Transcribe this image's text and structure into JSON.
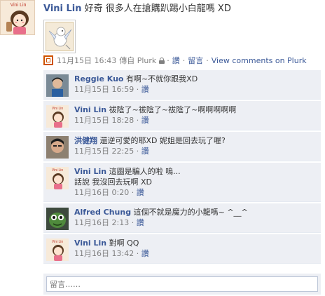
{
  "post": {
    "author": "Vini Lin",
    "text": "好奇 很多人在搶購趴踢小白龍嗎 XD",
    "avatar_caption": "Vini Lin"
  },
  "meta": {
    "timestamp": "11月15日 16:43",
    "via": "傳自 Plurk",
    "like_label": "讚",
    "comment_label": "留言",
    "view_comments_label": "View comments on Plurk",
    "dot": "·"
  },
  "comments": [
    {
      "author": "Reggie Kuo",
      "text": "有啊~不就你跟我XD",
      "timestamp": "11月15日 16:59",
      "like_label": "讚"
    },
    {
      "author": "Vini Lin",
      "text": "祓陰了~祓陰了~祓陰了~啊啊啊啊啊",
      "timestamp": "11月15日 18:28",
      "like_label": "讚",
      "avatar_caption": "Vini Lin"
    },
    {
      "author": "洪健翔",
      "text": "還逆可愛的耶XD 妮姐是回去玩了喔?",
      "timestamp": "11月15日 22:25",
      "like_label": "讚"
    },
    {
      "author": "Vini Lin",
      "text": "這圖是騙人的啦 嗚...",
      "text2": "話說 我沒回去玩啊 XD",
      "timestamp": "11月16日 0:20",
      "like_label": "讚",
      "avatar_caption": "Vini Lin"
    },
    {
      "author": "Alfred Chung",
      "text": "這個不就是魔力的小龍嗎~ ^__^",
      "timestamp": "11月16日 2:13",
      "like_label": "讚"
    },
    {
      "author": "Vini Lin",
      "text": "對啊 QQ",
      "timestamp": "11月16日 13:42",
      "like_label": "讚",
      "avatar_caption": "Vini Lin"
    }
  ],
  "reply": {
    "placeholder": "留言……"
  }
}
